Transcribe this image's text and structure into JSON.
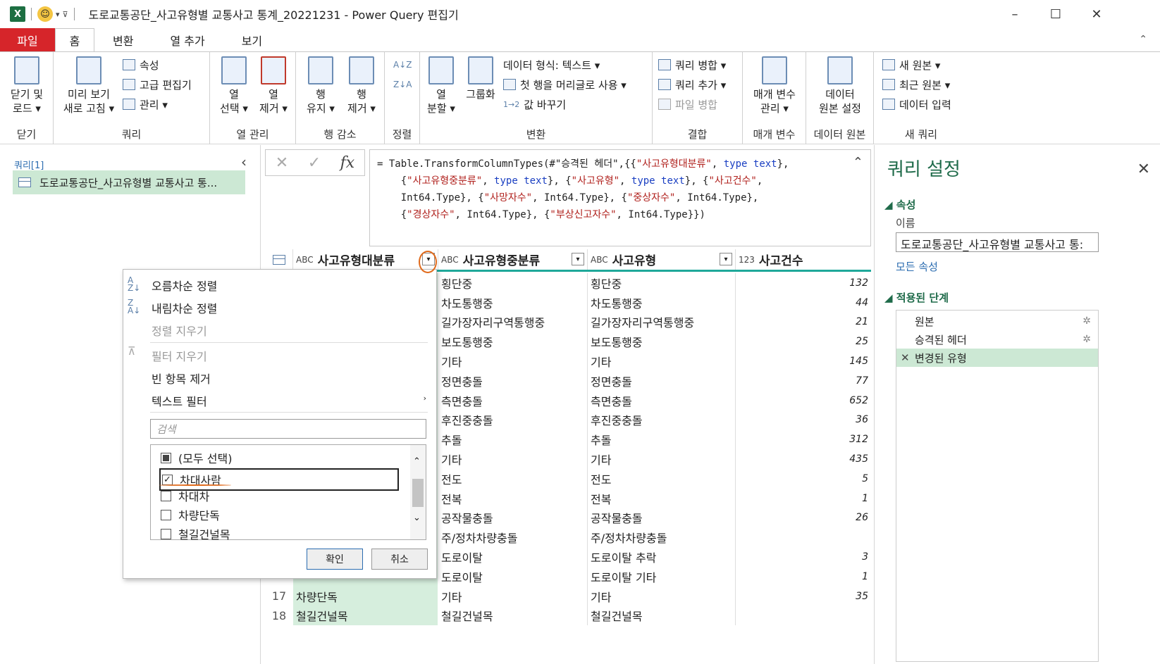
{
  "titlebar": {
    "title": "도로교통공단_사고유형별 교통사고 통계_20221231 - Power Query 편집기",
    "app_icon": "X",
    "qat_icons": [
      "smiley-icon",
      "dropdown-icon",
      "customize-icon"
    ],
    "controls": [
      "_",
      "☐",
      "✕"
    ]
  },
  "menu_tabs": [
    "파일",
    "홈",
    "변환",
    "열 추가",
    "보기"
  ],
  "ribbon": {
    "close": {
      "label1": "닫기 및",
      "label2": "로드 ▾",
      "group": "닫기"
    },
    "query": {
      "refresh1": "미리 보기",
      "refresh2": "새로 고침 ▾",
      "props": "속성",
      "adv": "고급 편집기",
      "manage": "관리 ▾",
      "group": "쿼리"
    },
    "cols": {
      "select1": "열",
      "select2": "선택 ▾",
      "remove1": "열",
      "remove2": "제거 ▾",
      "group": "열 관리"
    },
    "rows": {
      "keep1": "행",
      "keep2": "유지 ▾",
      "remove1": "행",
      "remove2": "제거 ▾",
      "group": "행 감소"
    },
    "sort": {
      "group": "정렬"
    },
    "transform": {
      "split1": "열",
      "split2": "분할 ▾",
      "groupby": "그룹화",
      "dtype": "데이터 형식: 텍스트 ▾",
      "firstrow": "첫 행을 머리글로 사용 ▾",
      "replace": "값 바꾸기",
      "group": "변환"
    },
    "combine": {
      "merge": "쿼리 병합 ▾",
      "append": "쿼리 추가 ▾",
      "files": "파일 병합",
      "group": "결합"
    },
    "params": {
      "l1": "매개 변수",
      "l2": "관리 ▾",
      "group": "매개 변수"
    },
    "source": {
      "l1": "데이터",
      "l2": "원본 설정",
      "group": "데이터 원본"
    },
    "newq": {
      "new": "새 원본 ▾",
      "recent": "최근 원본 ▾",
      "enter": "데이터 입력",
      "group": "새 쿼리"
    }
  },
  "queries": {
    "label": "쿼리[1]",
    "item": "도로교통공단_사고유형별 교통사고 통..."
  },
  "formula": {
    "fx": "fx",
    "cancel": "✕",
    "ok": "✓"
  },
  "grid": {
    "headers": [
      {
        "type": "ABC",
        "name": "사고유형대분류"
      },
      {
        "type": "ABC",
        "name": "사고유형중분류"
      },
      {
        "type": "ABC",
        "name": "사고유형"
      },
      {
        "type": "123",
        "name": "사고건수"
      }
    ],
    "rows": [
      {
        "n": "",
        "a": "",
        "b": "횡단중",
        "c": "횡단중",
        "d": "132"
      },
      {
        "n": "",
        "a": "",
        "b": "차도통행중",
        "c": "차도통행중",
        "d": "44"
      },
      {
        "n": "",
        "a": "",
        "b": "길가장자리구역통행중",
        "c": "길가장자리구역통행중",
        "d": "21"
      },
      {
        "n": "",
        "a": "",
        "b": "보도통행중",
        "c": "보도통행중",
        "d": "25"
      },
      {
        "n": "",
        "a": "",
        "b": "기타",
        "c": "기타",
        "d": "145"
      },
      {
        "n": "",
        "a": "",
        "b": "정면충돌",
        "c": "정면충돌",
        "d": "77"
      },
      {
        "n": "",
        "a": "",
        "b": "측면충돌",
        "c": "측면충돌",
        "d": "652"
      },
      {
        "n": "",
        "a": "",
        "b": "후진중충돌",
        "c": "후진중충돌",
        "d": "36"
      },
      {
        "n": "",
        "a": "",
        "b": "추돌",
        "c": "추돌",
        "d": "312"
      },
      {
        "n": "",
        "a": "",
        "b": "기타",
        "c": "기타",
        "d": "435"
      },
      {
        "n": "",
        "a": "",
        "b": "전도",
        "c": "전도",
        "d": "5"
      },
      {
        "n": "",
        "a": "",
        "b": "전복",
        "c": "전복",
        "d": "1"
      },
      {
        "n": "",
        "a": "",
        "b": "공작물충돌",
        "c": "공작물충돌",
        "d": "26"
      },
      {
        "n": "",
        "a": "",
        "b": "주/정차차량충돌",
        "c": "주/정차차량충돌",
        "d": ""
      },
      {
        "n": "",
        "a": "",
        "b": "도로이탈",
        "c": "도로이탈 추락",
        "d": "3"
      },
      {
        "n": "",
        "a": "",
        "b": "도로이탈",
        "c": "도로이탈 기타",
        "d": "1"
      },
      {
        "n": "17",
        "a": "차량단독",
        "b": "기타",
        "c": "기타",
        "d": "35"
      },
      {
        "n": "18",
        "a": "철길건널목",
        "b": "철길건널목",
        "c": "철길건널목",
        "d": ""
      }
    ]
  },
  "filter_menu": {
    "asc": "오름차순 정렬",
    "desc": "내림차순 정렬",
    "clear_sort": "정렬 지우기",
    "clear_filter": "필터 지우기",
    "remove_empty": "빈 항목 제거",
    "text_filter": "텍스트 필터",
    "search_placeholder": "검색",
    "items": [
      {
        "label": "(모두 선택)",
        "state": "partial"
      },
      {
        "label": "차대사람",
        "state": "checked"
      },
      {
        "label": "차대차",
        "state": "unchecked"
      },
      {
        "label": "차량단독",
        "state": "unchecked"
      },
      {
        "label": "철길건널목",
        "state": "unchecked"
      }
    ],
    "ok": "확인",
    "cancel": "취소"
  },
  "settings": {
    "title": "쿼리 설정",
    "props": "속성",
    "name_label": "이름",
    "name_value": "도로교통공단_사고유형별 교통사고 통:",
    "all_props": "모든 속성",
    "steps_label": "적용된 단계",
    "steps": [
      "원본",
      "승격된 헤더",
      "변경된 유형"
    ]
  },
  "colors": {
    "file_tab": "#d6252a",
    "selected_col": "#d6eedd",
    "accent": "#1f6b4a",
    "header_underline": "#1fa89a",
    "annotation": "#e06a1b"
  }
}
